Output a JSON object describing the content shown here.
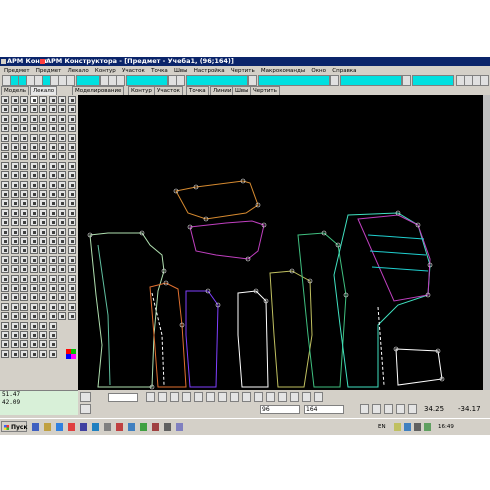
{
  "window": {
    "title_short": "АРМ Конст",
    "title": "АРМ Конструктора - [Предмет - Учеба1, (96;164)]"
  },
  "menu": [
    "Предмет",
    "Предмет",
    "Лекало",
    "Контур",
    "Участок",
    "Точка",
    "Швы",
    "Настройка",
    "Чертить",
    "Макрокоманды",
    "Окно",
    "Справка"
  ],
  "tabs": [
    "Модель",
    "Лекало",
    "Моделирование",
    "Контур",
    "Участок",
    "Точка",
    "Линии",
    "Швы",
    "Чертить"
  ],
  "coords": {
    "x": "51.47",
    "y": "42.09"
  },
  "bottom": {
    "field_a": "96",
    "field_b": "164",
    "readout_1": "34.25",
    "readout_2": "-34.17"
  },
  "taskbar": {
    "start_label": "Пуск",
    "lang": "EN",
    "clock": "16:49"
  },
  "colors": {
    "titlebar": "#0a246a",
    "canvas": "#000000",
    "accent_cyan": "#00e0e0",
    "coord_panel": "#d8f0d8"
  }
}
